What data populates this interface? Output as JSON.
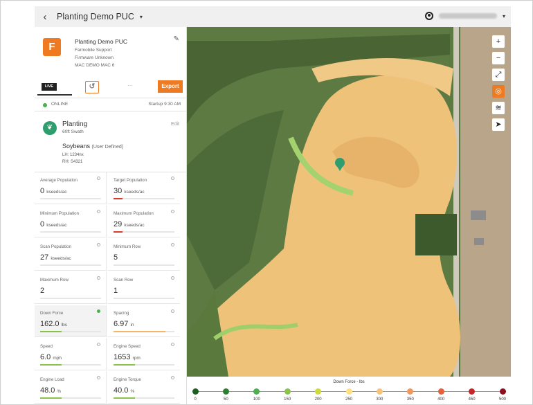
{
  "header": {
    "back": "‹",
    "title": "Planting Demo PUC",
    "caret": "▾"
  },
  "device": {
    "name": "Planting Demo PUC",
    "line2": "Farmobile Support",
    "line3": "Firmware Unknown",
    "line4": "MAC DEMO MAC 6",
    "live_label": "LIVE",
    "export_label": "Export",
    "status": "ONLINE",
    "startup": "Startup 9:30 AM"
  },
  "operation": {
    "name": "Planting",
    "swath": "60ft Swath",
    "edit_label": "Edit",
    "crop": "Soybeans",
    "crop_note": "(User Defined)",
    "lh": "LH: 1234nx",
    "rh": "RH: S4321"
  },
  "metrics": [
    {
      "label": "Average Population",
      "value": "0",
      "unit": "kseeds/ac",
      "bar_color": "#c9c9c9",
      "fill": 0
    },
    {
      "label": "Target Population",
      "value": "30",
      "unit": "kseeds/ac",
      "bar_color": "#d63b2c",
      "fill": 0.15
    },
    {
      "label": "Minimum Population",
      "value": "0",
      "unit": "kseeds/ac",
      "bar_color": "#c9c9c9",
      "fill": 0
    },
    {
      "label": "Maximum Population",
      "value": "29",
      "unit": "kseeds/ac",
      "bar_color": "#d63b2c",
      "fill": 0.15
    },
    {
      "label": "Scan Population",
      "value": "27",
      "unit": "kseeds/ac",
      "bar_color": "#c9c9c9",
      "fill": 0
    },
    {
      "label": "Minimum Row",
      "value": "5",
      "unit": "",
      "bar_color": "#c9c9c9",
      "fill": 0
    },
    {
      "label": "Maximum Row",
      "value": "2",
      "unit": "",
      "bar_color": "#c9c9c9",
      "fill": 0
    },
    {
      "label": "Scan Row",
      "value": "1",
      "unit": "",
      "bar_color": "#c9c9c9",
      "fill": 0
    },
    {
      "label": "Down Force",
      "value": "162.0",
      "unit": "lbs",
      "bar_color": "#8bc34a",
      "fill": 0.35
    },
    {
      "label": "Spacing",
      "value": "6.97",
      "unit": "in",
      "bar_color": "#f3b567",
      "fill": 0.85
    },
    {
      "label": "Speed",
      "value": "6.0",
      "unit": "mph",
      "bar_color": "#8bc34a",
      "fill": 0.35
    },
    {
      "label": "Engine Speed",
      "value": "1653",
      "unit": "rpm",
      "bar_color": "#8bc34a",
      "fill": 0.35
    },
    {
      "label": "Engine Load",
      "value": "48.0",
      "unit": "%",
      "bar_color": "#8bc34a",
      "fill": 0.35
    },
    {
      "label": "Engine Torque",
      "value": "40.0",
      "unit": "%",
      "bar_color": "#8bc34a",
      "fill": 0.35
    }
  ],
  "map_controls": [
    "+",
    "−",
    "⤢",
    "◎",
    "≋",
    "➤"
  ],
  "legend": {
    "title": "Down Force - lbs",
    "ticks": [
      "0",
      "50",
      "100",
      "150",
      "200",
      "250",
      "300",
      "350",
      "400",
      "450",
      "500"
    ],
    "colors": [
      "#1b5e20",
      "#2e7d32",
      "#4caf50",
      "#8bc34a",
      "#cddc39",
      "#ffe082",
      "#f7c47c",
      "#ef9a5a",
      "#e5603d",
      "#c62828",
      "#8e1020"
    ]
  }
}
